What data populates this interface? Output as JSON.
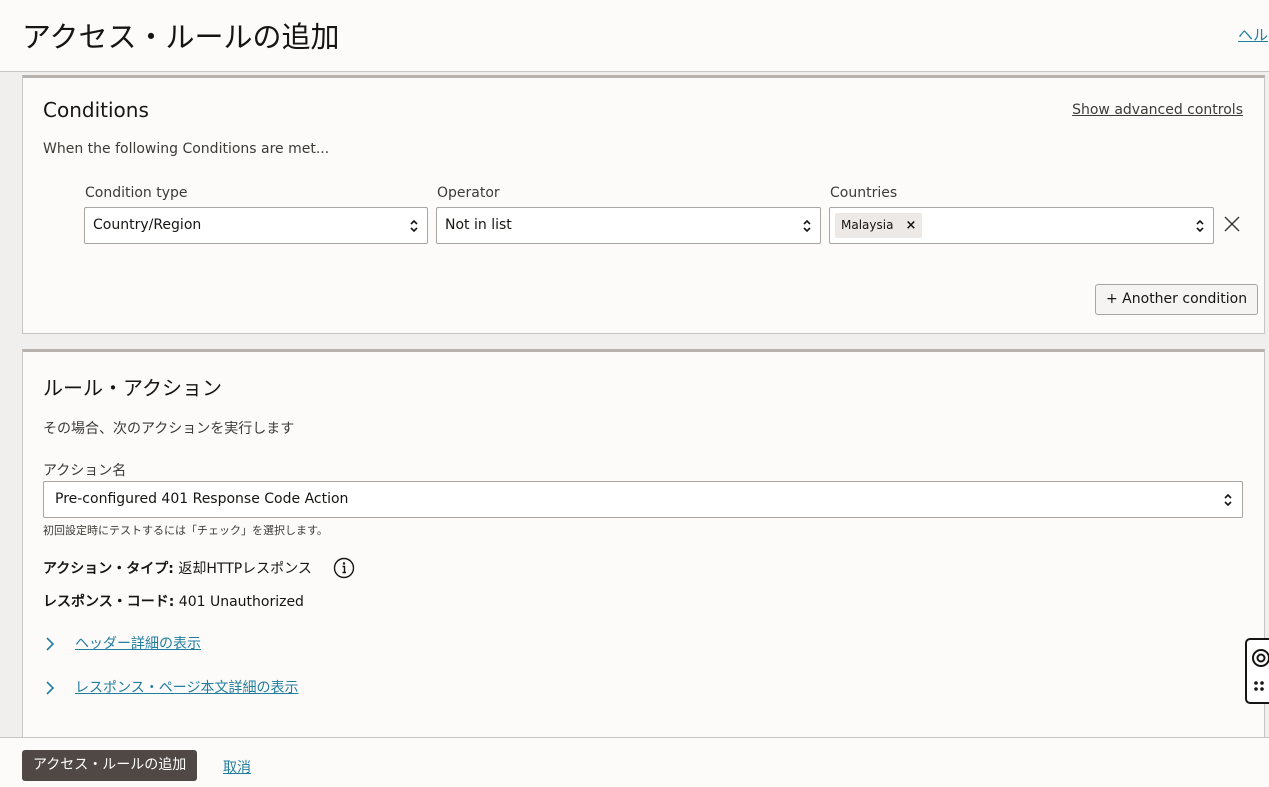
{
  "header": {
    "title": "アクセス・ルールの追加",
    "help_link": "ヘル"
  },
  "conditions": {
    "title": "Conditions",
    "advanced_link": "Show advanced controls",
    "intro": "When the following Conditions are met...",
    "condition_type": {
      "label": "Condition type",
      "value": "Country/Region"
    },
    "operator": {
      "label": "Operator",
      "value": "Not in list"
    },
    "countries": {
      "label": "Countries",
      "selected": [
        "Malaysia"
      ]
    },
    "another_button": "+ Another condition"
  },
  "action": {
    "title": "ルール・アクション",
    "intro": "その場合、次のアクションを実行します",
    "name_label": "アクション名",
    "name_value": "Pre-configured 401 Response Code Action",
    "help_text": "初回設定時にテストするには「チェック」を選択します。",
    "type_key": "アクション・タイプ:",
    "type_value": "返却HTTPレスポンス",
    "code_key": "レスポンス・コード:",
    "code_value": "401 Unauthorized",
    "disclosures": [
      "ヘッダー詳細の表示",
      "レスポンス・ページ本文詳細の表示"
    ]
  },
  "footer": {
    "primary_button": "アクセス・ルールの追加",
    "cancel_link": "取消"
  },
  "colors": {
    "link": "#227e9e",
    "primary_button_bg": "#4f4844",
    "panel_bg": "#fcfbfa",
    "page_bg": "#f1efed"
  }
}
